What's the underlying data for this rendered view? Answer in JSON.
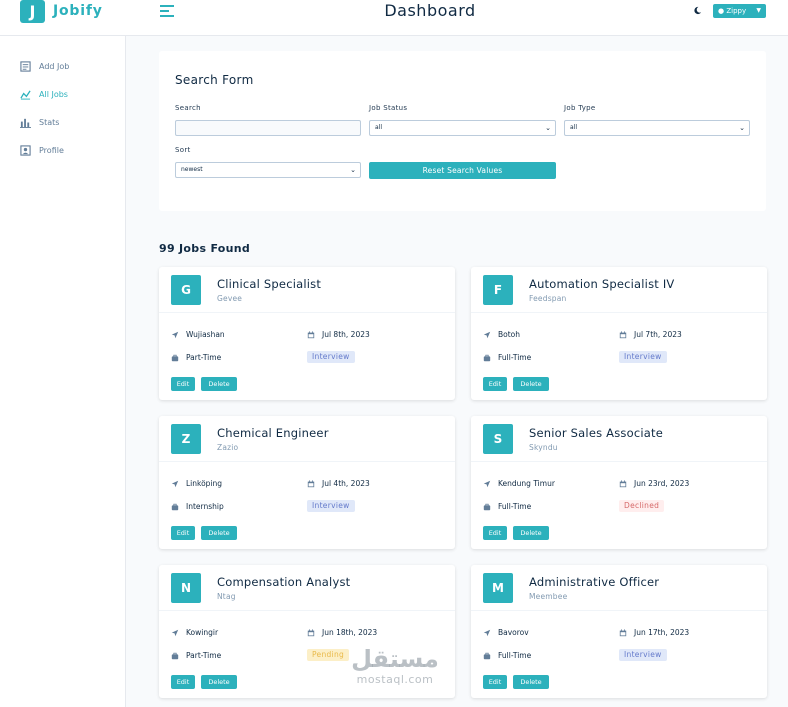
{
  "app": {
    "logo_letter": "J",
    "logo_text": "Jobify"
  },
  "header": {
    "title": "Dashboard",
    "theme_icon": "moon-icon",
    "user_icon": "user-circle-icon",
    "user_name": "Zippy",
    "user_caret": "caret-down-icon",
    "user_display": "Zippy"
  },
  "sidebar": {
    "items": [
      {
        "label": "Add Job",
        "icon": "form-icon",
        "active": false
      },
      {
        "label": "All Jobs",
        "icon": "chart-line-icon",
        "active": true
      },
      {
        "label": "Stats",
        "icon": "bar-chart-icon",
        "active": false
      },
      {
        "label": "Profile",
        "icon": "profile-icon",
        "active": false
      }
    ]
  },
  "search_form": {
    "title": "Search Form",
    "search_label": "Search",
    "search_value": "",
    "status_label": "Job Status",
    "status_value": "all",
    "type_label": "Job Type",
    "type_value": "all",
    "sort_label": "Sort",
    "sort_value": "newest",
    "reset_label": "Reset Search Values"
  },
  "jobs_found": "99 Jobs Found",
  "colors": {
    "primary": "#2cb1bc",
    "interview_bg": "#e0e8f9",
    "interview_text": "#647acb",
    "declined_bg": "#ffeeee",
    "declined_text": "#d66a6a",
    "pending_bg": "#fcefc7",
    "pending_text": "#e9b949"
  },
  "jobs": [
    {
      "letter": "G",
      "position": "Clinical Specialist",
      "company": "Gevee",
      "location": "Wujiashan",
      "date": "Jul 8th, 2023",
      "type": "Part-Time",
      "status": "Interview",
      "edit": "Edit",
      "delete": "Delete"
    },
    {
      "letter": "F",
      "position": "Automation Specialist IV",
      "company": "Feedspan",
      "location": "Botoh",
      "date": "Jul 7th, 2023",
      "type": "Full-Time",
      "status": "Interview",
      "edit": "Edit",
      "delete": "Delete"
    },
    {
      "letter": "Z",
      "position": "Chemical Engineer",
      "company": "Zazio",
      "location": "Linköping",
      "date": "Jul 4th, 2023",
      "type": "Internship",
      "status": "Interview",
      "edit": "Edit",
      "delete": "Delete"
    },
    {
      "letter": "S",
      "position": "Senior Sales Associate",
      "company": "Skyndu",
      "location": "Kendung Timur",
      "date": "Jun 23rd, 2023",
      "type": "Full-Time",
      "status": "Declined",
      "edit": "Edit",
      "delete": "Delete"
    },
    {
      "letter": "N",
      "position": "Compensation Analyst",
      "company": "Ntag",
      "location": "Kowingir",
      "date": "Jun 18th, 2023",
      "type": "Part-Time",
      "status": "Pending",
      "edit": "Edit",
      "delete": "Delete"
    },
    {
      "letter": "M",
      "position": "Administrative Officer",
      "company": "Meembee",
      "location": "Bavorov",
      "date": "Jun 17th, 2023",
      "type": "Full-Time",
      "status": "Interview",
      "edit": "Edit",
      "delete": "Delete"
    }
  ],
  "watermark": {
    "arabic": "مستقل",
    "latin": "mostaql.com"
  }
}
